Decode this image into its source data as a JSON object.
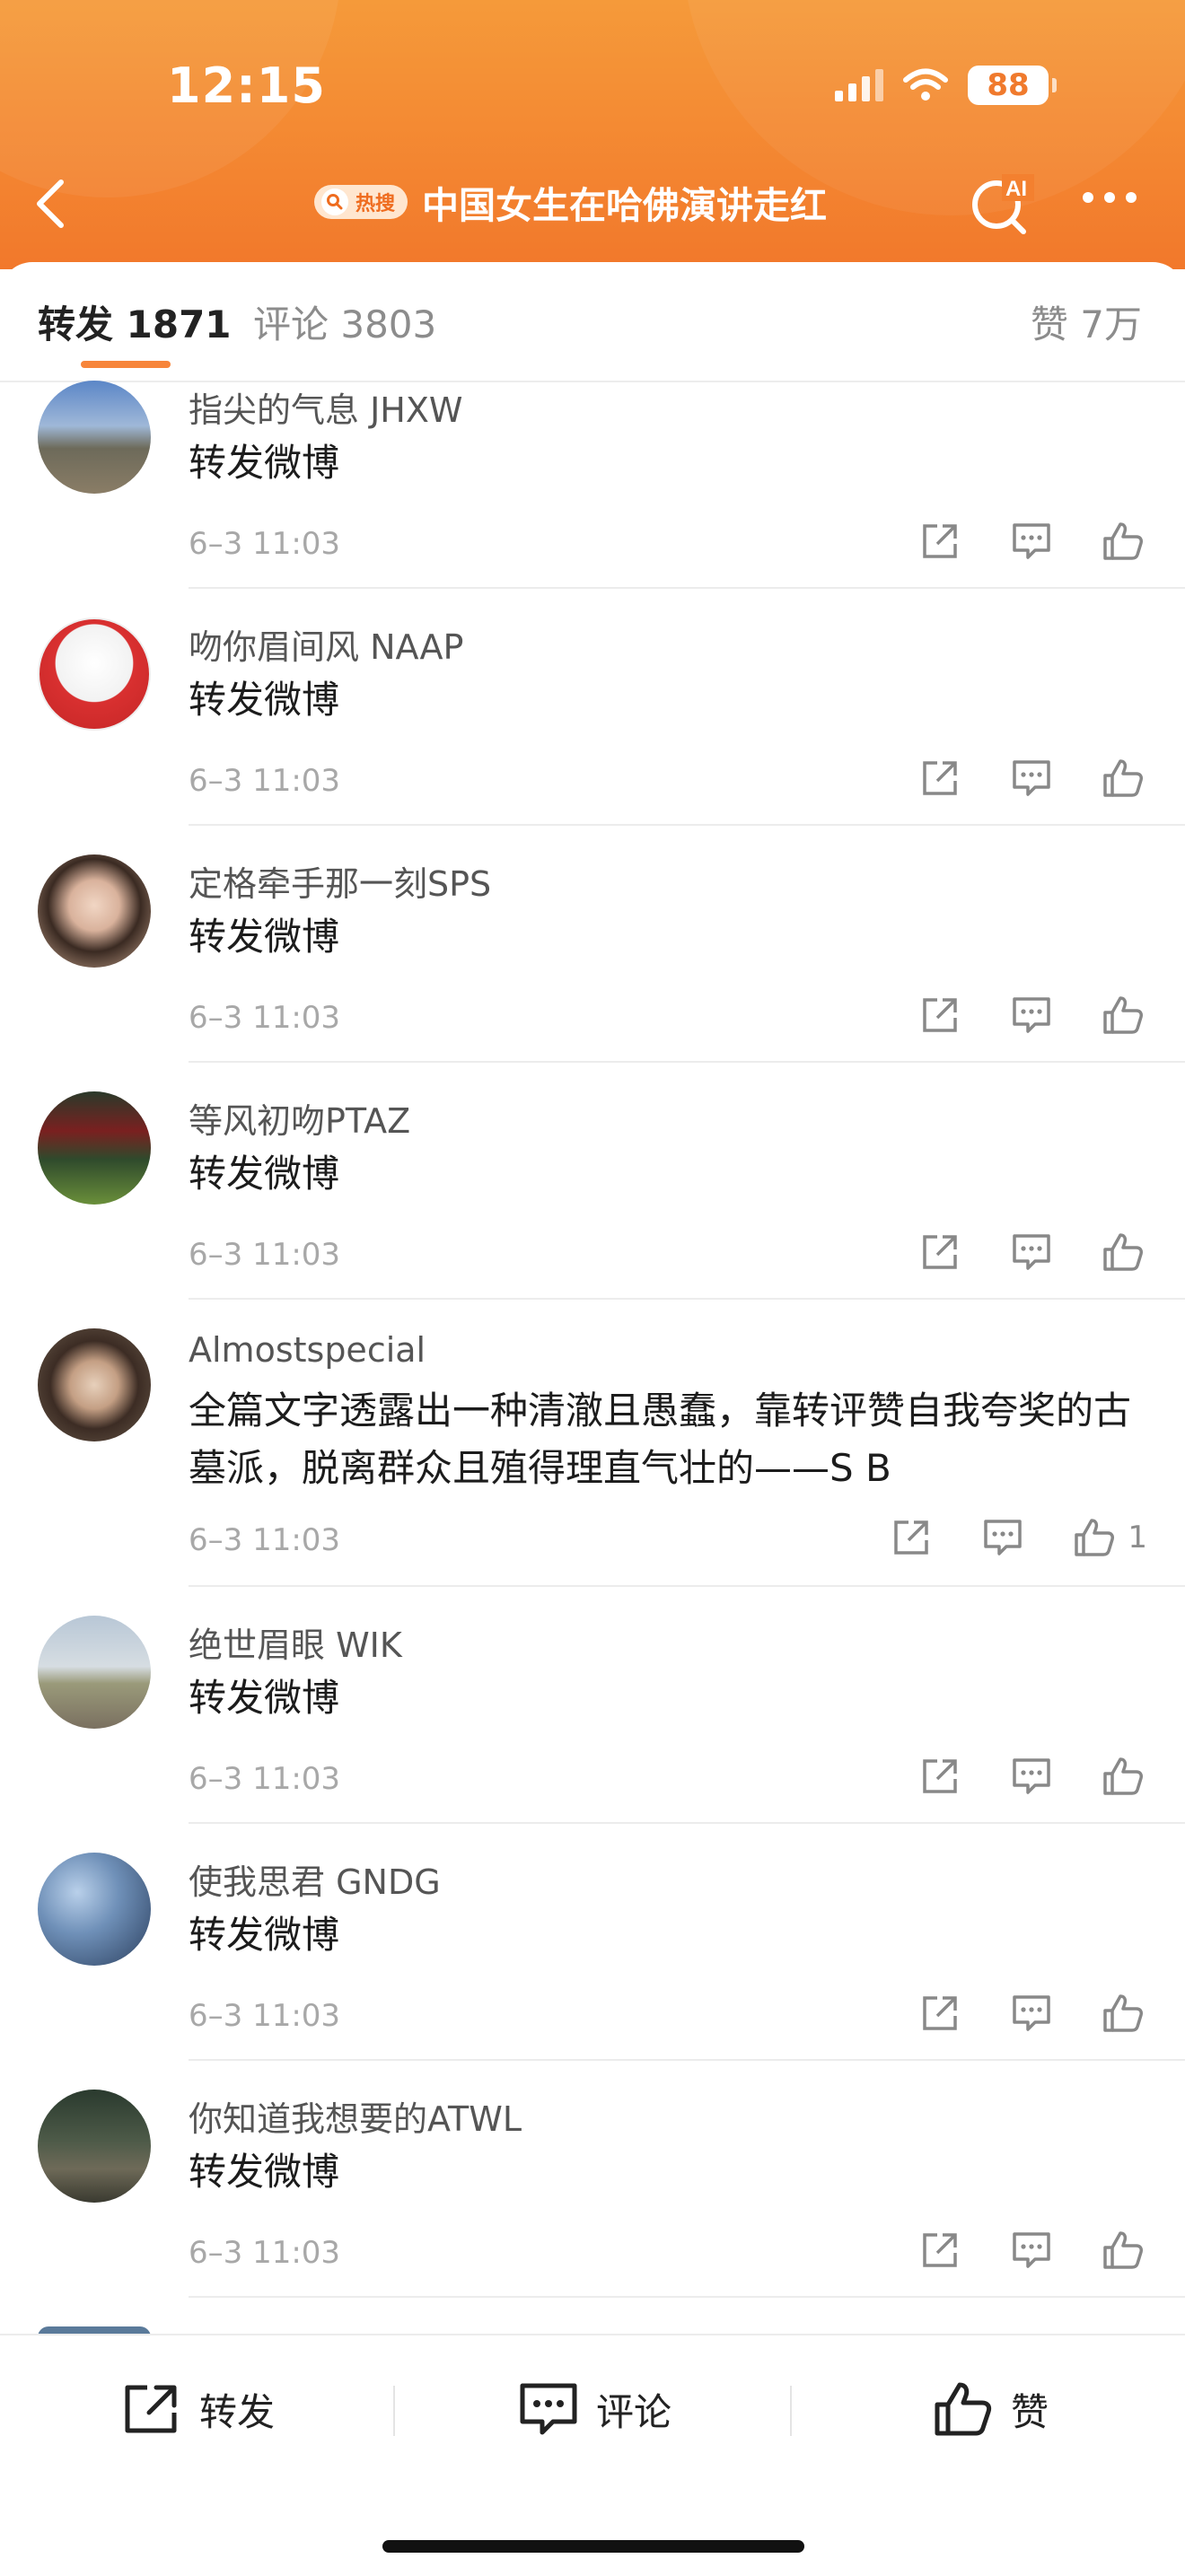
{
  "status_bar": {
    "time": "12:15",
    "battery": "88"
  },
  "nav": {
    "hot_badge": "热搜",
    "title": "中国女生在哈佛演讲走红",
    "ai_label": "AI"
  },
  "tabs": {
    "repost": "转发 1871",
    "comment": "评论 3803",
    "like": "赞 7万"
  },
  "reposts": [
    {
      "user": "指尖的气息 JHXW",
      "text": "转发微博",
      "time": "6–3 11:03",
      "likes": ""
    },
    {
      "user": "吻你眉间风 NAAP",
      "text": "转发微博",
      "time": "6–3 11:03",
      "likes": ""
    },
    {
      "user": "定格牵手那一刻SPS",
      "text": "转发微博",
      "time": "6–3 11:03",
      "likes": ""
    },
    {
      "user": "等风初吻PTAZ",
      "text": "转发微博",
      "time": "6–3 11:03",
      "likes": ""
    },
    {
      "user": "Almostspecial",
      "text": "全篇文字透露出一种清澈且愚蠢，靠转评赞自我夸奖的古墓派，脱离群众且殖得理直气壮的——S B",
      "time": "6–3 11:03",
      "likes": "1"
    },
    {
      "user": "绝世眉眼 WIK",
      "text": "转发微博",
      "time": "6–3 11:03",
      "likes": ""
    },
    {
      "user": "使我思君 GNDG",
      "text": "转发微博",
      "time": "6–3 11:03",
      "likes": ""
    },
    {
      "user": "你知道我想要的ATWL",
      "text": "转发微博",
      "time": "6–3 11:03",
      "likes": ""
    }
  ],
  "bottom_bar": {
    "repost": "转发",
    "comment": "评论",
    "like": "赞"
  },
  "colors": {
    "header_top": "#f59a3a",
    "header_bottom": "#f2782b",
    "accent": "#f7853a"
  }
}
